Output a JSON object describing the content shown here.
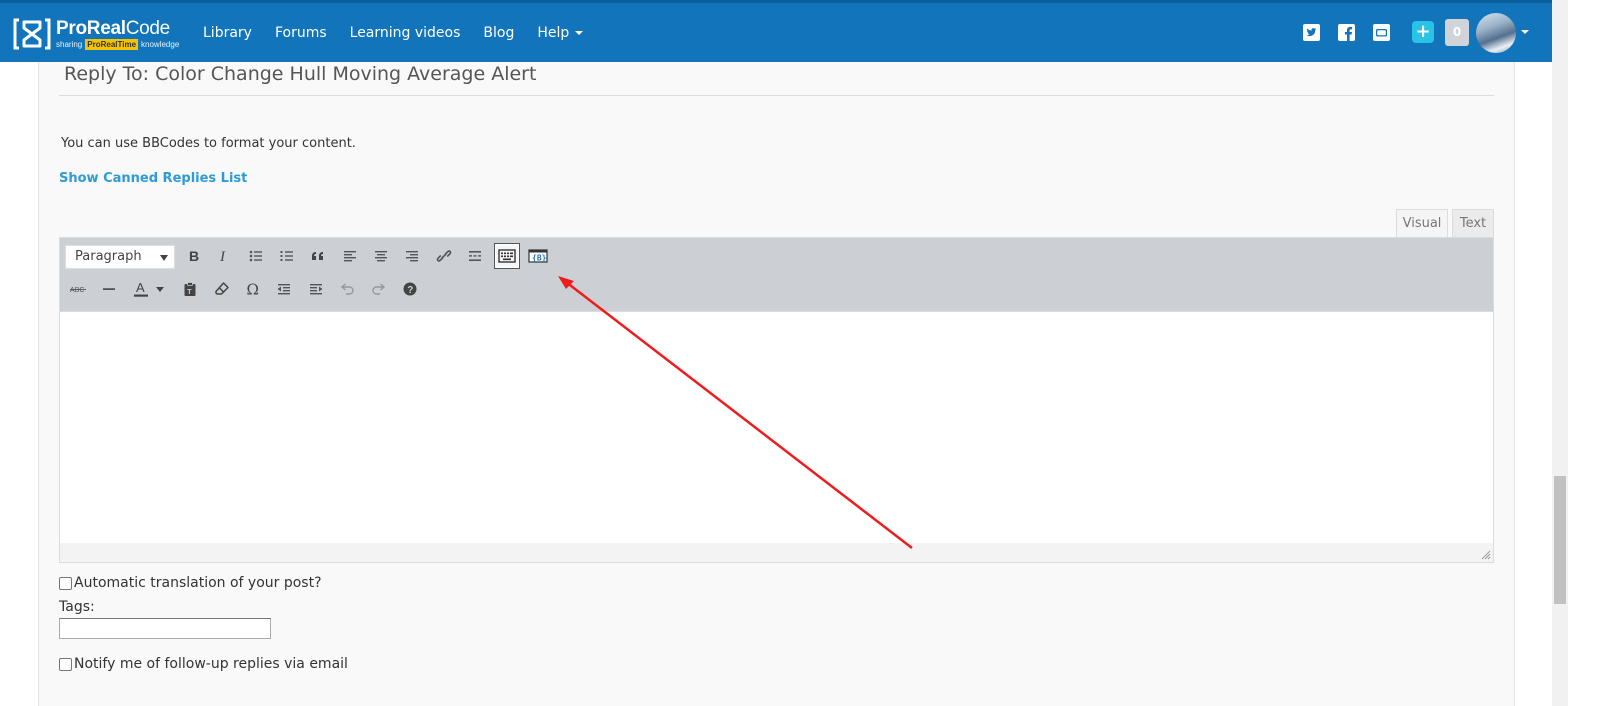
{
  "brand": {
    "name_bold": "ProReal",
    "name_light": "Code",
    "tag_pre": "sharing",
    "tag_highlight": "ProRealTime",
    "tag_post": "knowledge",
    "colors": {
      "navbar": "#1275bb",
      "accent": "#2e9bd6",
      "plus": "#29c3e5",
      "highlight": "#f5c400"
    }
  },
  "nav": {
    "items": [
      {
        "label": "Library"
      },
      {
        "label": "Forums"
      },
      {
        "label": "Learning videos"
      },
      {
        "label": "Blog"
      },
      {
        "label": "Help",
        "has_dropdown": true
      }
    ],
    "social_icons": [
      "twitter-icon",
      "facebook-icon",
      "youtube-icon"
    ],
    "plus_label": "+",
    "notification_count": "0"
  },
  "form": {
    "legend": "Reply To: Color Change Hull Moving Average Alert",
    "bbcode_note": "You can use BBCodes to format your content.",
    "canned_link": "Show Canned Replies List",
    "tabs": {
      "visual": "Visual",
      "text": "Text"
    },
    "format_select": {
      "selected": "Paragraph"
    },
    "toolbar_row1": [
      "bold-icon",
      "italic-icon",
      "bulleted-list-icon",
      "numbered-list-icon",
      "blockquote-icon",
      "align-left-icon",
      "align-center-icon",
      "align-right-icon",
      "link-icon",
      "read-more-icon",
      "toolbar-toggle-icon",
      "code-block-icon"
    ],
    "toolbar_row2": [
      "strikethrough-icon",
      "horizontal-line-icon",
      "text-color-icon",
      "paste-as-text-icon",
      "clear-formatting-icon",
      "special-character-icon",
      "outdent-icon",
      "indent-icon",
      "undo-icon",
      "redo-icon",
      "help-icon"
    ],
    "editor_content": "",
    "auto_translate_label": "Automatic translation of your post?",
    "tags_label": "Tags:",
    "tags_value": "",
    "notify_label": "Notify me of follow-up replies via email"
  }
}
